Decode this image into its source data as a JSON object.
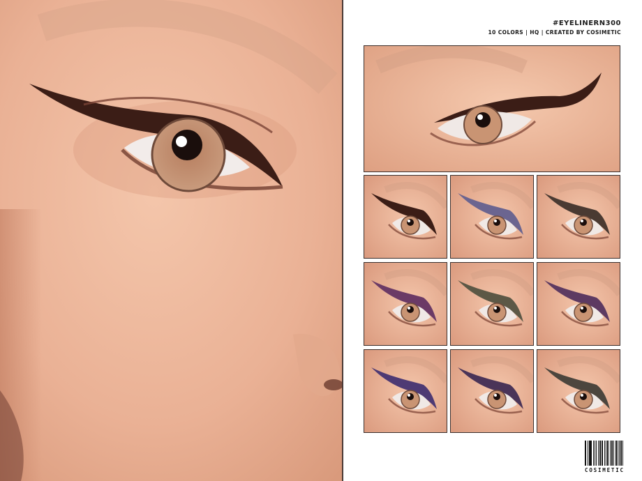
{
  "product": {
    "name": "#EYELINERN300",
    "subtitle": "10 COLORS | HQ | CREATED BY COSIMETIC"
  },
  "brand": {
    "logo_text": "COSIMETIC"
  },
  "colors": {
    "skin_light": "#f3c2a7",
    "skin_dark": "#d38e70",
    "iris": "#c99473",
    "pupil": "#1a0e0c",
    "frame": "#3a2e2b"
  },
  "swatches": [
    {
      "liner_color": "#3b1d16"
    },
    {
      "liner_color": "#6b6590"
    },
    {
      "liner_color": "#4a3a32"
    },
    {
      "liner_color": "#6b3a66"
    },
    {
      "liner_color": "#5c5846"
    },
    {
      "liner_color": "#5d3a62"
    },
    {
      "liner_color": "#4e3a74"
    },
    {
      "liner_color": "#4a3458"
    },
    {
      "liner_color": "#4c463e"
    }
  ]
}
